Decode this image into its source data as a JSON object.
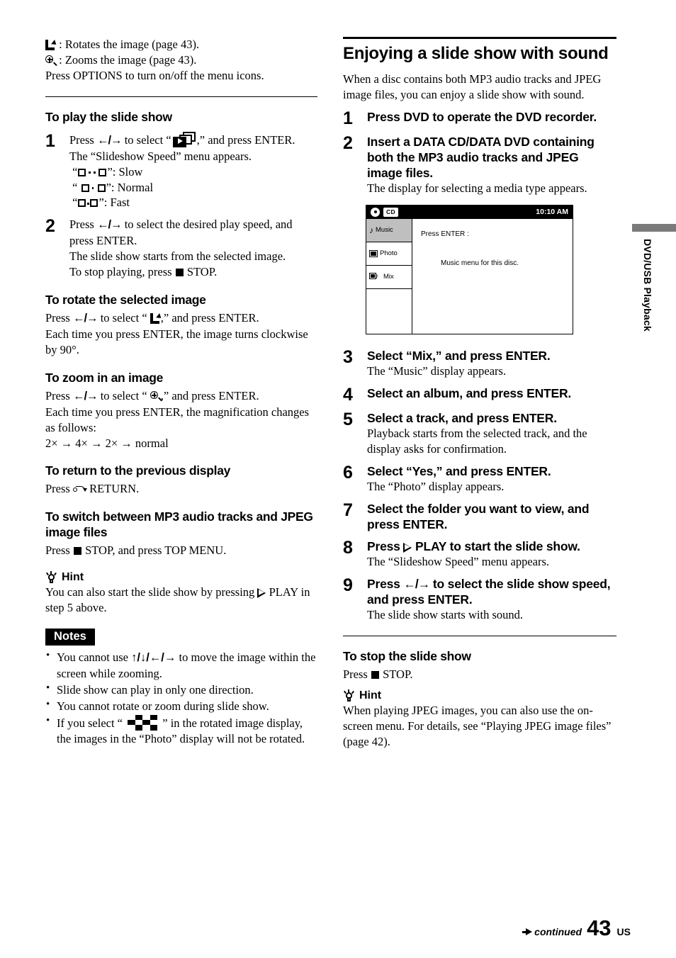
{
  "page": {
    "number": "43",
    "number_suffix": "US",
    "continued_label": "continued",
    "side_tab_label": "DVD/USB Playback",
    "side_tab_color": "#7a7a7a"
  },
  "left_column": {
    "intro": {
      "rotate_line_suffix": ": Rotates the image (page 43).",
      "zoom_line_suffix": ": Zooms the image (page 43).",
      "options_line": "Press OPTIONS to turn on/off the menu icons."
    },
    "play_slideshow": {
      "heading": "To play the slide show",
      "steps": [
        {
          "num": "1",
          "text_before_icon": "Press ",
          "arrows": "←/→",
          "text_after_arrows": " to select “",
          "text_after_icon": ",” and press ENTER.",
          "sub": "The “Slideshow Speed” menu appears.",
          "speeds": [
            {
              "quote_open": "“",
              "quote_close": "”:",
              "label": "Slow",
              "icon": "speed-slow-icon"
            },
            {
              "quote_open": "“",
              "quote_close": "”:",
              "label": "Normal",
              "icon": "speed-normal-icon"
            },
            {
              "quote_open": "“",
              "quote_close": "”:",
              "label": "Fast",
              "icon": "speed-fast-icon"
            }
          ]
        },
        {
          "num": "2",
          "text_before_arrows": "Press ",
          "arrows": "←/→",
          "text_after_arrows": " to select the desired play speed, and press ENTER.",
          "sub_1": "The slide show starts from the selected image.",
          "sub_2_before": "To stop playing, press ",
          "sub_2_after": " STOP."
        }
      ]
    },
    "rotate_section": {
      "heading": "To rotate the selected image",
      "line_1_before": "Press ",
      "arrows": "←/→",
      "line_1_mid": " to select “",
      "line_1_after": ",” and press ENTER.",
      "line_2": "Each time you press ENTER, the image turns clockwise by 90°."
    },
    "zoom_section": {
      "heading": "To zoom in an image",
      "line_1_before": "Press ",
      "arrows": "←/→",
      "line_1_mid": " to select “",
      "line_1_after": ",” and press ENTER.",
      "line_2": "Each time you press ENTER, the magnification changes as follows:",
      "magnification_sequence": "2× → 4× → 2× → normal"
    },
    "return_section": {
      "heading": "To return to the previous display",
      "line_before": "Press ",
      "line_after": " RETURN."
    },
    "switch_section": {
      "heading": "To switch between MP3 audio tracks and JPEG image files",
      "line_before": "Press ",
      "line_after": " STOP, and press TOP MENU."
    },
    "hint": {
      "title": "Hint",
      "text_before_icon": "You can also start the slide show by pressing ",
      "text_after_icon": " PLAY in step 5 above."
    },
    "notes": {
      "title": "Notes",
      "items": [
        {
          "before": "You cannot use ",
          "arrows": "↑/↓/←/→",
          "after": " to move the image within the screen while zooming."
        },
        {
          "before": "Slide show can play in only one direction."
        },
        {
          "before": "You cannot rotate or zoom during slide show."
        },
        {
          "before": "If you select “ ",
          "after": " ” in the rotated image display, the images in the “Photo” display will not be rotated."
        }
      ]
    }
  },
  "right_column": {
    "heading": "Enjoying a slide show with sound",
    "intro": "When a disc contains both MP3 audio tracks and JPEG image files, you can enjoy a slide show with sound.",
    "steps": [
      {
        "num": "1",
        "title": "Press DVD to operate the DVD recorder."
      },
      {
        "num": "2",
        "title": "Insert a DATA CD/DATA DVD containing both the MP3 audio tracks and JPEG image files.",
        "sub": "The display for selecting a media type appears."
      },
      {
        "num": "3",
        "title": "Select “Mix,” and press ENTER.",
        "sub": "The “Music” display appears."
      },
      {
        "num": "4",
        "title": "Select an album, and press ENTER."
      },
      {
        "num": "5",
        "title": "Select a track, and press ENTER.",
        "sub": "Playback starts from the selected track, and the display asks for confirmation."
      },
      {
        "num": "6",
        "title": "Select “Yes,” and press ENTER.",
        "sub": "The “Photo” display appears."
      },
      {
        "num": "7",
        "title": "Select the folder you want to view, and press ENTER."
      },
      {
        "num": "8",
        "title_before": "Press ",
        "title_after": " PLAY to start the slide show.",
        "sub": "The “Slideshow Speed” menu appears."
      },
      {
        "num": "9",
        "title_before": "Press ",
        "arrows": "←/→",
        "title_after": " to select the slide show speed, and press ENTER.",
        "sub": "The slide show starts with sound."
      }
    ],
    "tv_screen": {
      "time": "10:10 AM",
      "disc_badge": "CD",
      "menu_items": [
        {
          "label": "Music",
          "icon": "music-note-icon",
          "selected": true
        },
        {
          "label": "Photo",
          "icon": "photo-icon",
          "selected": false
        },
        {
          "label": "Mix",
          "icon": "mix-icon",
          "selected": false
        }
      ],
      "prompt": "Press ENTER :",
      "message": "Music menu for this disc."
    },
    "stop_section": {
      "heading": "To stop the slide show",
      "line_before": "Press ",
      "line_after": " STOP."
    },
    "hint": {
      "title": "Hint",
      "text": "When playing JPEG images, you can also use the on-screen menu. For details, see “Playing JPEG image files” (page 42)."
    }
  }
}
